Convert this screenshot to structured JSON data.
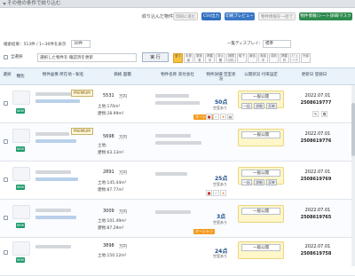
{
  "header": {
    "title": "その他の条件で絞り込む"
  },
  "filter": {
    "label": "絞り込んだ物件を",
    "btn_print": "印刷に進む",
    "btn_csv": "CSV出力",
    "btn_preview": "印刷プレビュー",
    "btn_disabled": "物件情報を一括で",
    "btn_green": "物件情報(シート詳細/マスク作)"
  },
  "results": {
    "count_text": "検索結果：513件 / 1~30件を表示",
    "per_page": "30件"
  },
  "toolbar": {
    "select_all": "全選択",
    "bulk_select": "選択した物件を  確認済を更新",
    "exec": "実 行",
    "display_label": "一覧ディスプレイ：",
    "display_value": "標準",
    "pills": [
      "全て",
      "未更新",
      "更新済",
      "掲載中",
      "非公開",
      "期限切れ",
      "取下",
      "報告",
      "商談中",
      "成約",
      "掲載外",
      "ビューア",
      "外部"
    ]
  },
  "columns": [
    "選択",
    "種別",
    "物件画像\n所在地・駅名",
    "価格\n面積",
    "物件名称\n売付会社",
    "物件詳細\n空室状況",
    "公開状況\n付帯設定",
    "更新日\n登録日"
  ],
  "rows": [
    {
      "type": "新築",
      "badge": "NEW",
      "badge_color": "#1d9b6c",
      "price": "5531",
      "unit": "万円",
      "area_land": "土地:170m²",
      "area_build": "建物:28.99m²",
      "stat_big": "50点",
      "stat_small": "空室あり",
      "pub": "一般公開",
      "date1": "2022.07.01",
      "date2": "2508619777"
    },
    {
      "type": "新築",
      "badge": "NEW",
      "badge_color": "#1d9b6c",
      "price": "5698",
      "unit": "万円",
      "area_land": "土地:",
      "area_build": "建物:63.13m²",
      "stat_big": "",
      "stat_small": "",
      "pub": "一般公開",
      "date1": "2022.07.01",
      "date2": "2508619776"
    },
    {
      "type": "新築",
      "badge": "NEW",
      "badge_color": "#1d9b6c",
      "price": "2891",
      "unit": "万円",
      "area_land": "土地:145.44m²",
      "area_build": "建物:87.77m²",
      "stat_big": "25点",
      "stat_small": "空室あり",
      "pub": "一般公開",
      "date1": "2022.07.01",
      "date2": "2508619769"
    },
    {
      "type": "新築",
      "badge": "NEW",
      "badge_color": "#1d9b6c",
      "price": "3009",
      "unit": "万円",
      "area_land": "土地:101.49m²",
      "area_build": "建物:87.29m²",
      "stat_big": "3点",
      "stat_small": "空室あり",
      "pub": "一般公開",
      "date1": "2022.07.01",
      "date2": "2508619765"
    },
    {
      "type": "新築",
      "badge": "NEW",
      "badge_color": "#1d9b6c",
      "price": "3898",
      "unit": "万円",
      "area_land": "土地:150.12m²",
      "area_build": "建物:",
      "stat_big": "24点",
      "stat_small": "空室あり",
      "pub": "一般公開",
      "date1": "2022.07.01",
      "date2": "2508619758"
    }
  ],
  "tags": {
    "premium": "PREMIUM",
    "ocean": "オーシャン"
  },
  "misc": {
    "mbtn1": "一括",
    "mbtn2": "詳細",
    "mbtn3": "反映"
  }
}
